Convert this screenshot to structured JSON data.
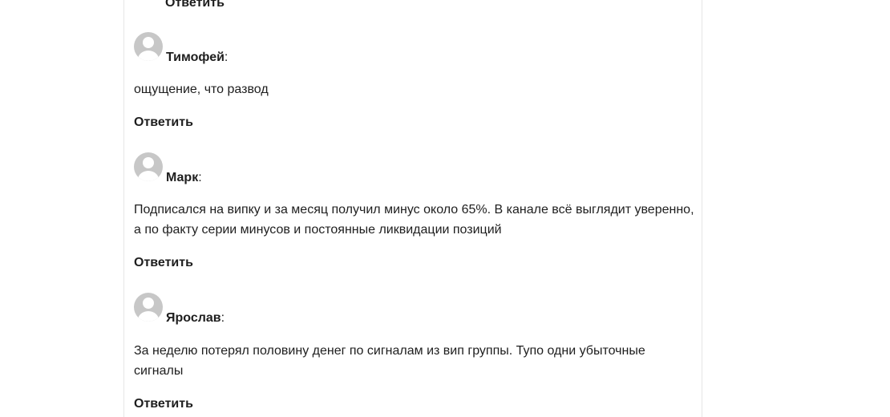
{
  "reply_label": "Ответить",
  "comments": [
    {
      "author": "Тимофей",
      "text": "ощущение, что развод"
    },
    {
      "author": "Марк",
      "text": "Подписался на випку и за месяц получил минус около 65%. В канале всё выглядит уверенно, а по факту серии минусов и постоянные ликвидации позиций"
    },
    {
      "author": "Ярослав",
      "text": "За неделю потерял половину денег по сигналам из вип группы. Тупо одни убыточные сигналы"
    }
  ]
}
